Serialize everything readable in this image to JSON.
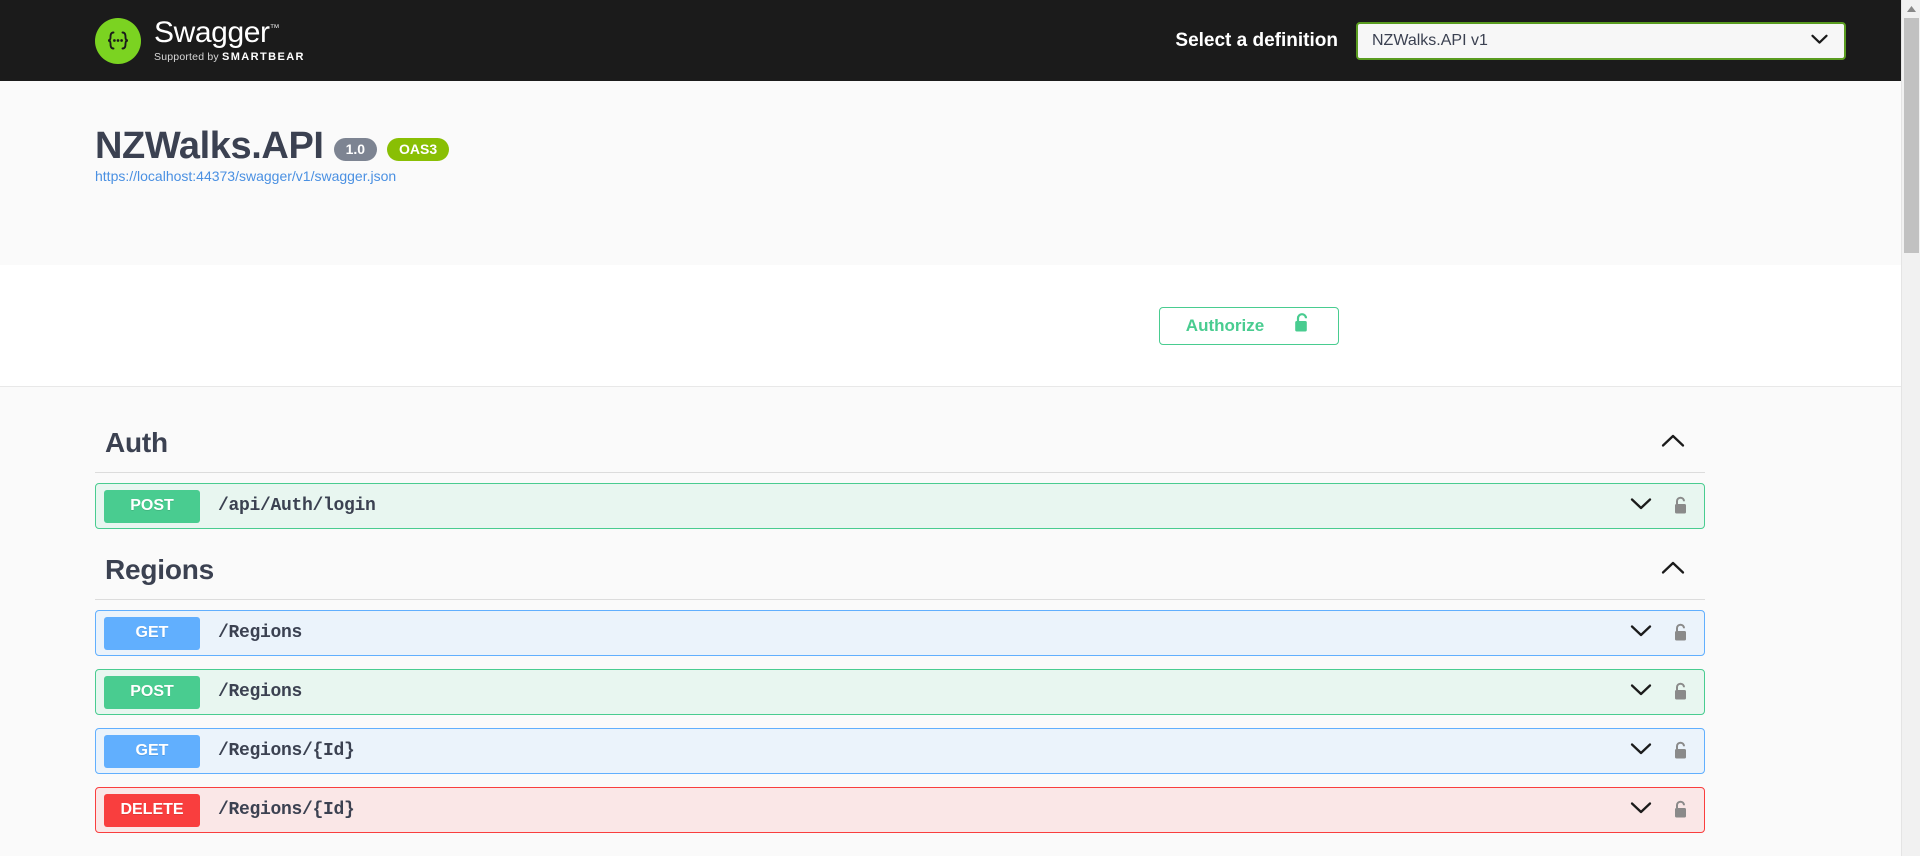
{
  "topbar": {
    "logo_title": "Swagger",
    "logo_tm": "™",
    "logo_supported_prefix": "Supported by",
    "logo_supported_brand": "SMARTBEAR",
    "definition_label": "Select a definition",
    "definition_selected": "NZWalks.API v1",
    "definition_options": [
      "NZWalks.API v1"
    ]
  },
  "info": {
    "title": "NZWalks.API",
    "version_badge": "1.0",
    "spec_badge": "OAS3",
    "spec_url": "https://localhost:44373/swagger/v1/swagger.json"
  },
  "auth_bar": {
    "authorize_label": "Authorize"
  },
  "sections": [
    {
      "name": "Auth",
      "expanded": true,
      "operations": [
        {
          "method": "POST",
          "method_class": "post",
          "path": "/api/Auth/login",
          "locked": false
        }
      ]
    },
    {
      "name": "Regions",
      "expanded": true,
      "operations": [
        {
          "method": "GET",
          "method_class": "get",
          "path": "/Regions",
          "locked": false
        },
        {
          "method": "POST",
          "method_class": "post",
          "path": "/Regions",
          "locked": false
        },
        {
          "method": "GET",
          "method_class": "get",
          "path": "/Regions/{Id}",
          "locked": false
        },
        {
          "method": "DELETE",
          "method_class": "delete",
          "path": "/Regions/{Id}",
          "locked": false
        }
      ]
    }
  ],
  "colors": {
    "topbar_bg": "#1b1b1b",
    "brand_green": "#7bd321",
    "get": "#61affe",
    "post": "#49cc90",
    "delete": "#f93e3e",
    "oas_badge": "#89bf04",
    "version_badge": "#7d8492",
    "link": "#4a90e2",
    "text": "#3b4151"
  }
}
